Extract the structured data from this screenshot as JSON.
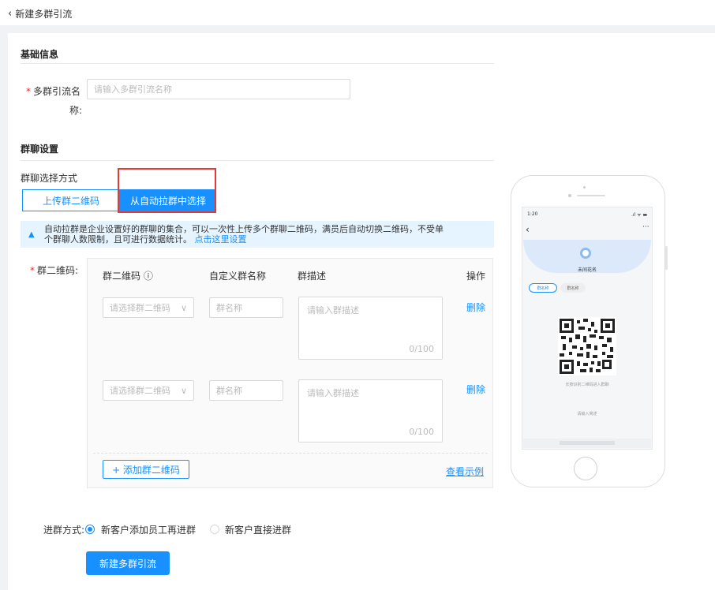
{
  "header": {
    "back_icon": "chevron-left-icon",
    "title": "新建多群引流"
  },
  "basic": {
    "section_title": "基础信息",
    "name_label_1": "多群引流名",
    "name_label_2": "称:",
    "name_placeholder": "请输入多群引流名称"
  },
  "group": {
    "section_title": "群聊设置",
    "method_label": "群聊选择方式",
    "tabs": [
      "上传群二维码",
      "从自动拉群中选择"
    ],
    "notice_line1": "自动拉群是企业设置好的群聊的集合，可以一次性上传多个群聊二维码，满员后自动切换二维码，不受单",
    "notice_line2": "个群聊人数限制，且可进行数据统计。",
    "notice_link": "点击这里设置",
    "qr_label": "群二维码:",
    "columns": [
      "群二维码 ⓘ",
      "自定义群名称",
      "群描述",
      "操作"
    ],
    "rows": [
      {
        "select": "请选择群二维码",
        "name": "群名称",
        "desc": "请输入群描述",
        "count": "0/100",
        "action": "删除"
      },
      {
        "select": "请选择群二维码",
        "name": "群名称",
        "desc": "请输入群描述",
        "count": "0/100",
        "action": "删除"
      }
    ],
    "add_button": "+ 添加群二维码",
    "example_link": "查看示例"
  },
  "join": {
    "label": "进群方式:",
    "options": [
      "新客户添加员工再进群",
      "新客户直接进群"
    ],
    "selected": 0
  },
  "submit": "新建多群引流",
  "preview": {
    "time": "1:20",
    "status": ".ıl ᯤ ▬",
    "title": "未间花名",
    "tags": [
      "群名称",
      "群名称"
    ],
    "hint": "长按识别二维码进入群聊",
    "desc": "请输入简述"
  },
  "colors": {
    "primary": "#1890ff",
    "danger": "#f5222d",
    "highlight": "#e53935"
  }
}
